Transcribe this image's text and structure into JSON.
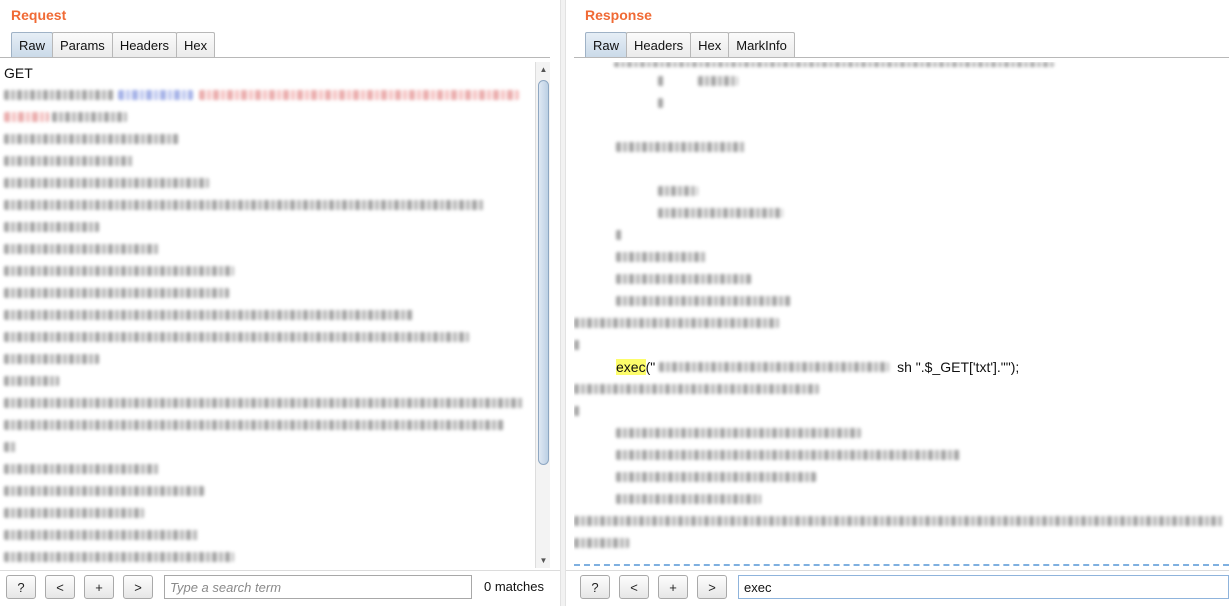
{
  "request": {
    "title": "Request",
    "tabs": [
      {
        "label": "Raw",
        "active": true
      },
      {
        "label": "Params",
        "active": false
      },
      {
        "label": "Headers",
        "active": false
      },
      {
        "label": "Hex",
        "active": false
      }
    ],
    "first_line": "GET",
    "search": {
      "placeholder": "Type a search term",
      "value": "",
      "matches": "0 matches"
    }
  },
  "response": {
    "title": "Response",
    "tabs": [
      {
        "label": "Raw",
        "active": true
      },
      {
        "label": "Headers",
        "active": false
      },
      {
        "label": "Hex",
        "active": false
      },
      {
        "label": "MarkInfo",
        "active": false
      }
    ],
    "highlight_term": "exec",
    "exec_open": "(\"",
    "exec_tail": " sh \".$_GET['txt'].\"\");",
    "search": {
      "value": "exec"
    }
  },
  "buttons": {
    "help": "?",
    "prev": "<",
    "add": "+",
    "next": ">"
  }
}
